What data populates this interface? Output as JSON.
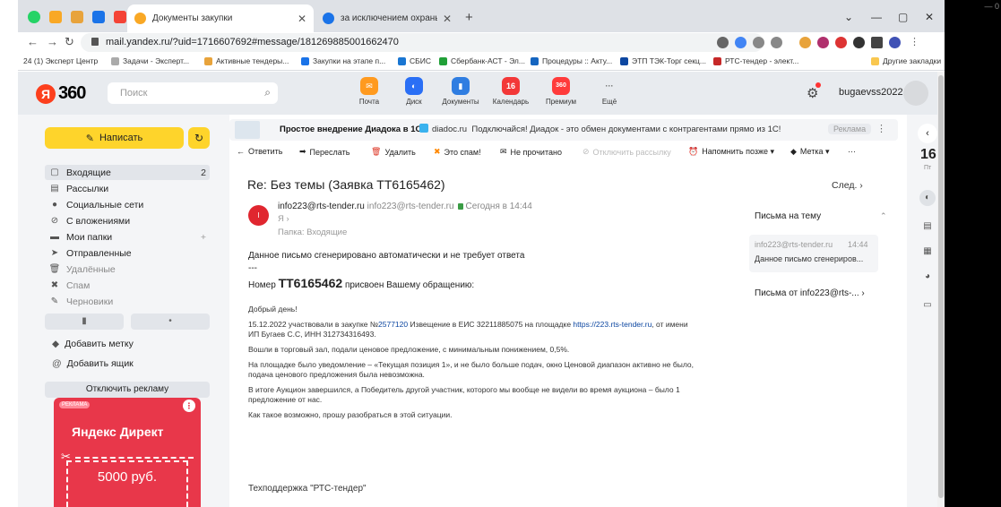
{
  "tabs": [
    {
      "title": "Документы закупки",
      "color": "#f9a825"
    },
    {
      "title": "за исключением охраны ,постав",
      "color": "#1a73e8"
    }
  ],
  "url": "mail.yandex.ru/?uid=1716607692#message/181269885001662470",
  "bookmarks": [
    "24 (1) Эксперт Центр",
    "Задачи - Эксперт...",
    "Активные тендеры...",
    "Закупки на этапе п...",
    "СБИС",
    "Сбербанк-АСТ - Эл...",
    "Процедуры :: Акту...",
    "ЭТП ТЭК-Торг секц...",
    "РТС-тендер - элект..."
  ],
  "other_bookmarks": "Другие закладки",
  "header": {
    "logo_text": "360",
    "search_placeholder": "Поиск",
    "services": [
      {
        "label": "Почта",
        "color": "#ff9a1f",
        "glyph": "✉"
      },
      {
        "label": "Диск",
        "color": "#2a6ff5",
        "glyph": "◐"
      },
      {
        "label": "Документы",
        "color": "#2f7de1",
        "glyph": "▮"
      },
      {
        "label": "Календарь",
        "color": "#f33838",
        "glyph": "16"
      },
      {
        "label": "Премиум",
        "color": "#ff3b3b",
        "glyph": "360"
      },
      {
        "label": "Ещё",
        "color": "transparent",
        "glyph": "···"
      }
    ],
    "username": "bugaevss2022"
  },
  "sidebar": {
    "compose": "Написать",
    "folders": [
      {
        "label": "Входящие",
        "count": "2",
        "icon": "▢"
      },
      {
        "label": "Рассылки",
        "count": "",
        "icon": "▤"
      },
      {
        "label": "Социальные сети",
        "count": "",
        "icon": "●"
      },
      {
        "label": "С вложениями",
        "count": "",
        "icon": "⊘"
      },
      {
        "label": "Мои папки",
        "count": "+",
        "icon": "▬"
      },
      {
        "label": "Отправленные",
        "count": "",
        "icon": "➤"
      },
      {
        "label": "Удалённые",
        "count": "",
        "icon": "🗑"
      },
      {
        "label": "Спам",
        "count": "",
        "icon": "✖"
      },
      {
        "label": "Черновики",
        "count": "",
        "icon": "✎"
      }
    ],
    "add_label": "Добавить метку",
    "add_box": "Добавить ящик",
    "disable_ads": "Отключить рекламу",
    "ad_tag": "РЕКЛАМА",
    "ad_brand": "Яндекс Директ",
    "ad_price": "5000 руб."
  },
  "adstrip": {
    "title": "Простое внедрение Диадока в 1С",
    "domain": "diadoc.ru",
    "text": "Подключайся! Диадок - это обмен документами с контрагентами прямо из 1С!",
    "label": "Реклама"
  },
  "toolbar": [
    {
      "label": "Ответить",
      "icon": "←",
      "disabled": false
    },
    {
      "label": "Переслать",
      "icon": "➡",
      "disabled": false
    },
    {
      "label": "Удалить",
      "icon": "🗑",
      "disabled": false
    },
    {
      "label": "Это спам!",
      "icon": "✖",
      "disabled": false
    },
    {
      "label": "Не прочитано",
      "icon": "✉",
      "disabled": false
    },
    {
      "label": "Отключить рассылку",
      "icon": "⊘",
      "disabled": true
    },
    {
      "label": "Напомнить позже ▾",
      "icon": "⏰",
      "disabled": false
    },
    {
      "label": "Метка ▾",
      "icon": "◆",
      "disabled": false
    },
    {
      "label": "···",
      "icon": "",
      "disabled": false
    }
  ],
  "message": {
    "subject_prefix": "Re:",
    "subject": "Без темы (Заявка ТТ6165462)",
    "next": "След. ›",
    "sender_name": "info223@rts-tender.ru",
    "sender_addr": "info223@rts-tender.ru",
    "date": "Сегодня в 14:44",
    "to": "Я ›",
    "folder": "Папка: Входящие",
    "line1": "Данное письмо сгенерировано автоматически и не требует ответа",
    "sep": "---",
    "num_pre": "Номер",
    "ticket": "ТТ6165462",
    "num_post": "присвоен Вашему обращению:",
    "greet": "Добрый день!",
    "p1_a": "15.12.2022 участвовали в закупке №",
    "p1_num": "2577120",
    "p1_b": " Извещение в ЕИС 32211885075 на площадке ",
    "p1_link": "https://223.rts-tender.ru",
    "p1_c": ", от имени",
    "p1_d": "ИП Бугаев С.С, ИНН 312734316493.",
    "p2": "Вошли в торговый зал, подали ценовое предложение, с минимальным понижением, 0,5%.",
    "p3_a": "На площадке было уведомление – «Текущая позиция 1», и не было больше подач, окно Ценовой диапазон активно не было,",
    "p3_b": "подача ценового предложения была невозможна.",
    "p4_a": "В итоге Аукцион завершился, а Победитель другой участник, которого мы вообще не видели во время аукциона – было 1",
    "p4_b": "предложение от нас.",
    "p5": "Как такое возможно, прошу разобраться в этой ситуации.",
    "sign": "Техподдержка \"РТС-тендер\""
  },
  "thread": {
    "header": "Письма на тему",
    "item_from": "info223@rts-tender.ru",
    "item_time": "14:44",
    "item_preview": "Данное письмо сгенериров...",
    "letters_from": "Письма от info223@rts-... ›"
  },
  "rail": {
    "day": "16",
    "weekday": "Пт"
  }
}
